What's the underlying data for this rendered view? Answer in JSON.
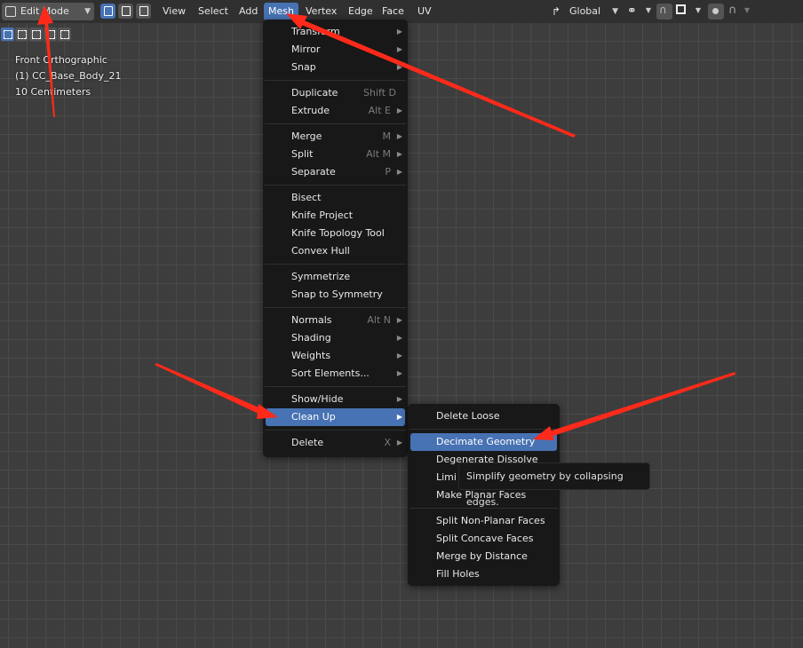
{
  "header": {
    "mode": "Edit Mode",
    "menus": [
      "View",
      "Select",
      "Add",
      "Mesh",
      "Vertex",
      "Edge",
      "Face",
      "UV"
    ],
    "active_menu": "Mesh",
    "transform_orientation": "Global"
  },
  "viewport": {
    "view_name": "Front Orthographic",
    "object_name": "(1) CC_Base_Body_21",
    "scale": "10 Centimeters"
  },
  "mesh_menu": {
    "items": [
      {
        "label": "Transform",
        "shortcut": "",
        "submenu": true
      },
      {
        "label": "Mirror",
        "shortcut": "",
        "submenu": true
      },
      {
        "label": "Snap",
        "shortcut": "",
        "submenu": true
      },
      {
        "label": "Duplicate",
        "shortcut": "Shift D",
        "submenu": false
      },
      {
        "label": "Extrude",
        "shortcut": "Alt E",
        "submenu": true
      },
      {
        "label": "Merge",
        "shortcut": "M",
        "submenu": true
      },
      {
        "label": "Split",
        "shortcut": "Alt M",
        "submenu": true
      },
      {
        "label": "Separate",
        "shortcut": "P",
        "submenu": true
      },
      {
        "label": "Bisect",
        "shortcut": "",
        "submenu": false
      },
      {
        "label": "Knife Project",
        "shortcut": "",
        "submenu": false
      },
      {
        "label": "Knife Topology Tool",
        "shortcut": "",
        "submenu": false
      },
      {
        "label": "Convex Hull",
        "shortcut": "",
        "submenu": false
      },
      {
        "label": "Symmetrize",
        "shortcut": "",
        "submenu": false
      },
      {
        "label": "Snap to Symmetry",
        "shortcut": "",
        "submenu": false
      },
      {
        "label": "Normals",
        "shortcut": "Alt N",
        "submenu": true
      },
      {
        "label": "Shading",
        "shortcut": "",
        "submenu": true
      },
      {
        "label": "Weights",
        "shortcut": "",
        "submenu": true
      },
      {
        "label": "Sort Elements...",
        "shortcut": "",
        "submenu": true
      },
      {
        "label": "Show/Hide",
        "shortcut": "",
        "submenu": true
      },
      {
        "label": "Clean Up",
        "shortcut": "",
        "submenu": true
      },
      {
        "label": "Delete",
        "shortcut": "X",
        "submenu": true
      }
    ]
  },
  "cleanup_menu": {
    "items": [
      {
        "label": "Delete Loose"
      },
      {
        "label": "Decimate Geometry"
      },
      {
        "label": "Degenerate Dissolve"
      },
      {
        "label": "Limi"
      },
      {
        "label": "Make Planar Faces"
      },
      {
        "label": "Split Non-Planar Faces"
      },
      {
        "label": "Split Concave Faces"
      },
      {
        "label": "Merge by Distance"
      },
      {
        "label": "Fill Holes"
      }
    ]
  },
  "tooltip": {
    "text": "Simplify geometry by collapsing edges."
  },
  "colors": {
    "accent": "#4772b3",
    "annotation_arrow": "#ff2a1a",
    "menu_bg": "#181818",
    "header_bg": "#303030",
    "viewport_bg": "#3d3d3d"
  }
}
